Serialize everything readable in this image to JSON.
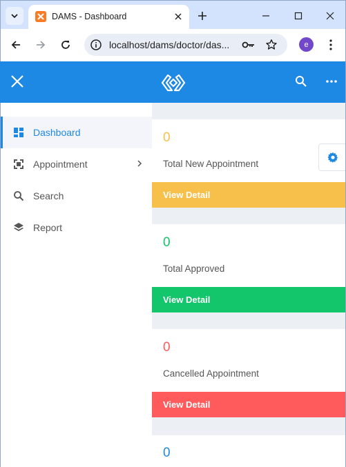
{
  "browser": {
    "tab_title": "DAMS - Dashboard",
    "url": "localhost/dams/doctor/das...",
    "profile_initial": "e"
  },
  "sidebar": {
    "items": [
      {
        "label": "Dashboard",
        "icon": "dashboard-icon",
        "active": true
      },
      {
        "label": "Appointment",
        "icon": "appointment-icon",
        "has_submenu": true
      },
      {
        "label": "Search",
        "icon": "search-icon"
      },
      {
        "label": "Report",
        "icon": "layers-icon"
      }
    ]
  },
  "cards": [
    {
      "count": "0",
      "label": "Total New Appointment",
      "action": "View Detail",
      "color": "#f7c04a"
    },
    {
      "count": "0",
      "label": "Total Approved",
      "action": "View Detail",
      "color": "#13c56b"
    },
    {
      "count": "0",
      "label": "Cancelled Appointment",
      "action": "View Detail",
      "color": "#ff5b5c"
    },
    {
      "count": "0",
      "label": "",
      "action": "",
      "color": "#1e88e5"
    }
  ],
  "colors": {
    "header": "#1e88e5",
    "accent": "#1e88e5"
  }
}
